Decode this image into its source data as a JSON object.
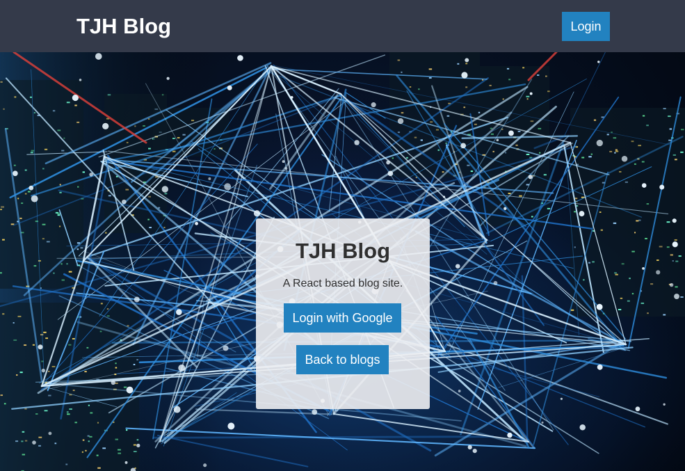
{
  "header": {
    "brand": "TJH Blog",
    "login_label": "Login"
  },
  "card": {
    "title": "TJH Blog",
    "subtitle": "A React based blog site.",
    "google_login_label": "Login with Google",
    "back_label": "Back to blogs"
  },
  "colors": {
    "header_bg": "#343a4a",
    "button_bg": "#2282c0",
    "button_text": "#ffffff",
    "card_bg": "#f0f0f2",
    "card_text": "#2f2f2f"
  },
  "background": {
    "image": "night city network lines photo"
  }
}
